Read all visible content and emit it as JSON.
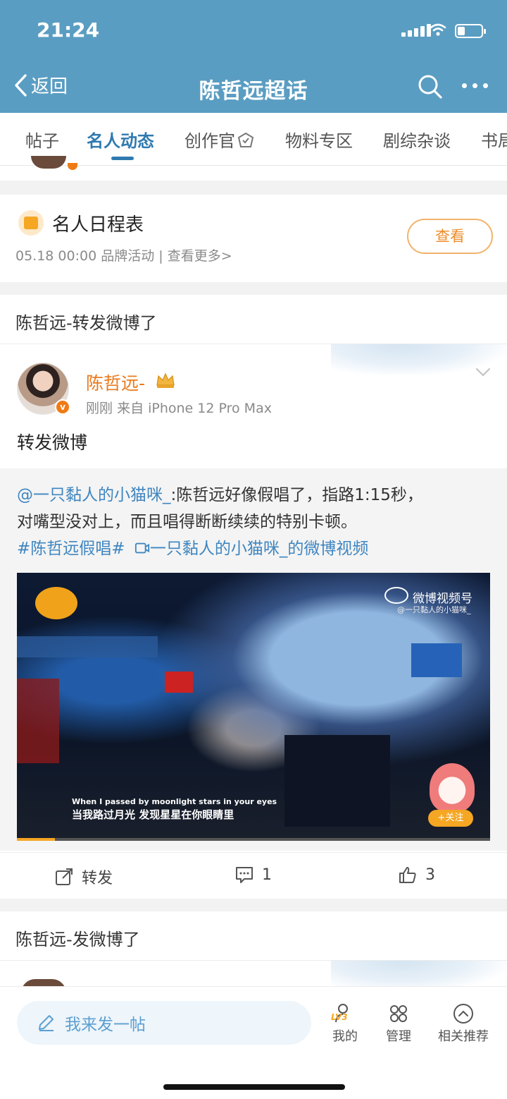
{
  "status_bar": {
    "time": "21:24"
  },
  "nav": {
    "back_label": "返回",
    "title": "陈哲远超话"
  },
  "tabs": [
    {
      "label": "帖子"
    },
    {
      "label": "名人动态"
    },
    {
      "label": "创作官"
    },
    {
      "label": "物料专区"
    },
    {
      "label": "剧综杂谈"
    },
    {
      "label": "书局"
    }
  ],
  "schedule": {
    "title": "名人日程表",
    "date": "05.18 00:00",
    "category": "品牌活动",
    "divider": "|",
    "more": "查看更多>",
    "button": "查看"
  },
  "section1": {
    "label": "陈哲远-转发微博了"
  },
  "post": {
    "username": "陈哲远-",
    "time": "刚刚",
    "source": "来自 iPhone 12 Pro Max",
    "text": "转发微博",
    "repost": {
      "author": "@一只黏人的小猫咪_",
      "line1_rest": ":陈哲远好像假唱了，指路1:15秒，",
      "line2": "对嘴型没对上，而且唱得断断续续的特别卡顿。",
      "hashtag": "#陈哲远假唱#",
      "video_link": "一只黏人的小猫咪_的微博视频",
      "video": {
        "watermark": "微博视频号",
        "watermark_sub": "@一只黏人的小猫咪_",
        "subtitle_en": "When I passed by moonlight stars in your eyes",
        "subtitle_zh": "当我路过月光 发现星星在你眼睛里",
        "follow": "+关注",
        "progress": 0.08
      }
    },
    "actions": {
      "repost_label": "转发",
      "comment_count": "1",
      "like_count": "3"
    }
  },
  "section2": {
    "label": "陈哲远-发微博了"
  },
  "bottom_bar": {
    "compose_placeholder": "我来发一帖",
    "level": "LV3",
    "tabs": [
      {
        "label": "我的"
      },
      {
        "label": "管理"
      },
      {
        "label": "相关推荐"
      }
    ]
  },
  "colors": {
    "header": "#5a9dc2",
    "accent": "#2f7ab0",
    "orange": "#ea7a1c",
    "link": "#3f86c0"
  }
}
